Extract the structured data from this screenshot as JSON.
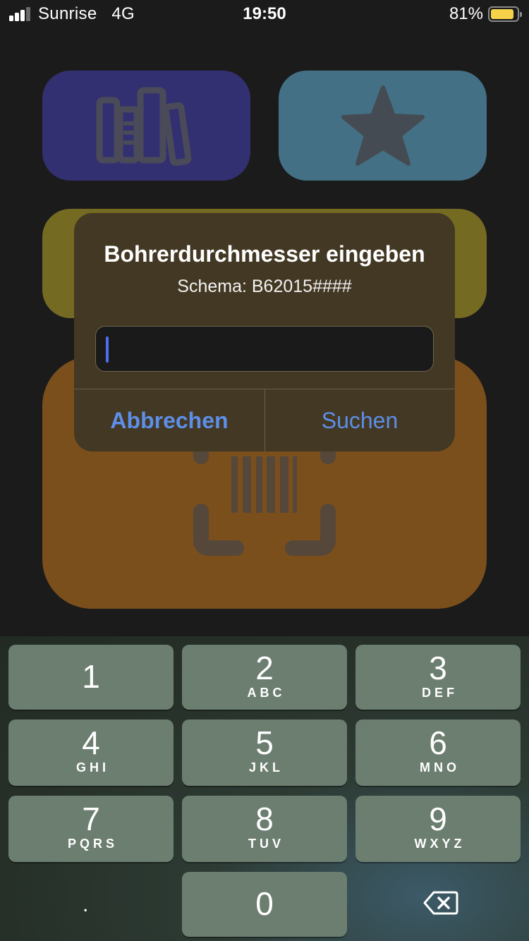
{
  "status_bar": {
    "carrier": "Sunrise",
    "network": "4G",
    "time": "19:50",
    "battery_percent": "81%",
    "battery_level": 0.81,
    "battery_color": "#f5d24a"
  },
  "tiles": [
    {
      "name": "library",
      "icon": "books-icon",
      "color": "#323070"
    },
    {
      "name": "favorites",
      "icon": "star-icon",
      "color": "#447086"
    },
    {
      "name": "yellow",
      "color": "#756a22"
    },
    {
      "name": "scan",
      "icon": "barcode-scan-icon",
      "color": "#7a4f1c"
    }
  ],
  "alert": {
    "title": "Bohrerdurchmesser eingeben",
    "message": "Schema: B62015####",
    "input_value": "",
    "cancel_label": "Abbrechen",
    "confirm_label": "Suchen",
    "button_color": "#5d8ee8"
  },
  "keypad": {
    "keys": [
      {
        "num": "1",
        "letters": ""
      },
      {
        "num": "2",
        "letters": "ABC"
      },
      {
        "num": "3",
        "letters": "DEF"
      },
      {
        "num": "4",
        "letters": "GHI"
      },
      {
        "num": "5",
        "letters": "JKL"
      },
      {
        "num": "6",
        "letters": "MNO"
      },
      {
        "num": "7",
        "letters": "PQRS"
      },
      {
        "num": "8",
        "letters": "TUV"
      },
      {
        "num": "9",
        "letters": "WXYZ"
      },
      {
        "num": "0",
        "letters": ""
      }
    ],
    "decimal": ".",
    "delete_icon": "backspace-icon"
  }
}
